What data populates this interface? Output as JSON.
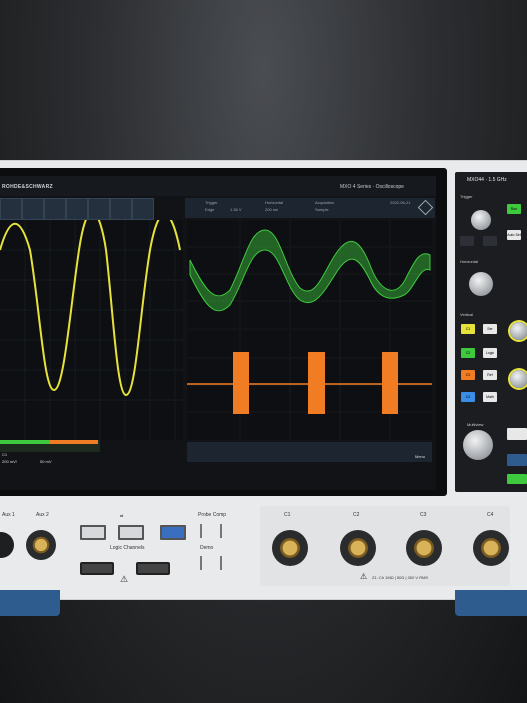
{
  "header": {
    "brand": "ROHDE&SCHWARZ",
    "model": "MXO 4 Series · Oscilloscope",
    "panel_model": "MXO44 · 1.5 GHz"
  },
  "toolbar": {
    "items": [
      "Cursor",
      "Measure",
      "Add",
      "Delete",
      "Undo",
      "Run",
      "Preset",
      "Help"
    ]
  },
  "status_bar": {
    "trigger": "Trigger",
    "trigger_edge": "Edge",
    "trigger_level": "1.36 V",
    "horizontal": "Horizontal",
    "horizontal_value": "200 ns/",
    "acquisition": "Acquisition",
    "acq_value": "Sample",
    "date": "2022-06-21"
  },
  "channel_labels": {
    "c1": "C1",
    "c1_scale": "200 mV/",
    "c1_scale2": "50 mV",
    "menu": "Menu"
  },
  "right_panel": {
    "trigger_label": "Trigger",
    "level_label": "Level",
    "run_label": "Run",
    "auto_label": "Auto Set",
    "horizontal_label": "Horizontal",
    "scale_label": "Scale",
    "vertical_label": "Vertical",
    "multiview_label": "Multiview",
    "c1": "C1",
    "c2": "C2",
    "c3": "C3",
    "c4": "C4",
    "ser": "Ser",
    "logic": "Logic",
    "ref": "Ref",
    "math": "Math"
  },
  "front_panel": {
    "aux1": "Aux 1",
    "aux2": "Aux 2",
    "logic_channels": "Logic Channels",
    "probe_comp": "Probe Comp",
    "demo": "Demo",
    "ch1": "C1",
    "ch2": "C2",
    "ch3": "C3",
    "ch4": "C4",
    "warning": "Z1: Ch 1MΩ | 50Ω | 300 V RMS"
  },
  "colors": {
    "ch1": "#e6e23a",
    "ch2": "#3ec93e",
    "ch3": "#f07c24",
    "accent": "#2e5c8f"
  }
}
